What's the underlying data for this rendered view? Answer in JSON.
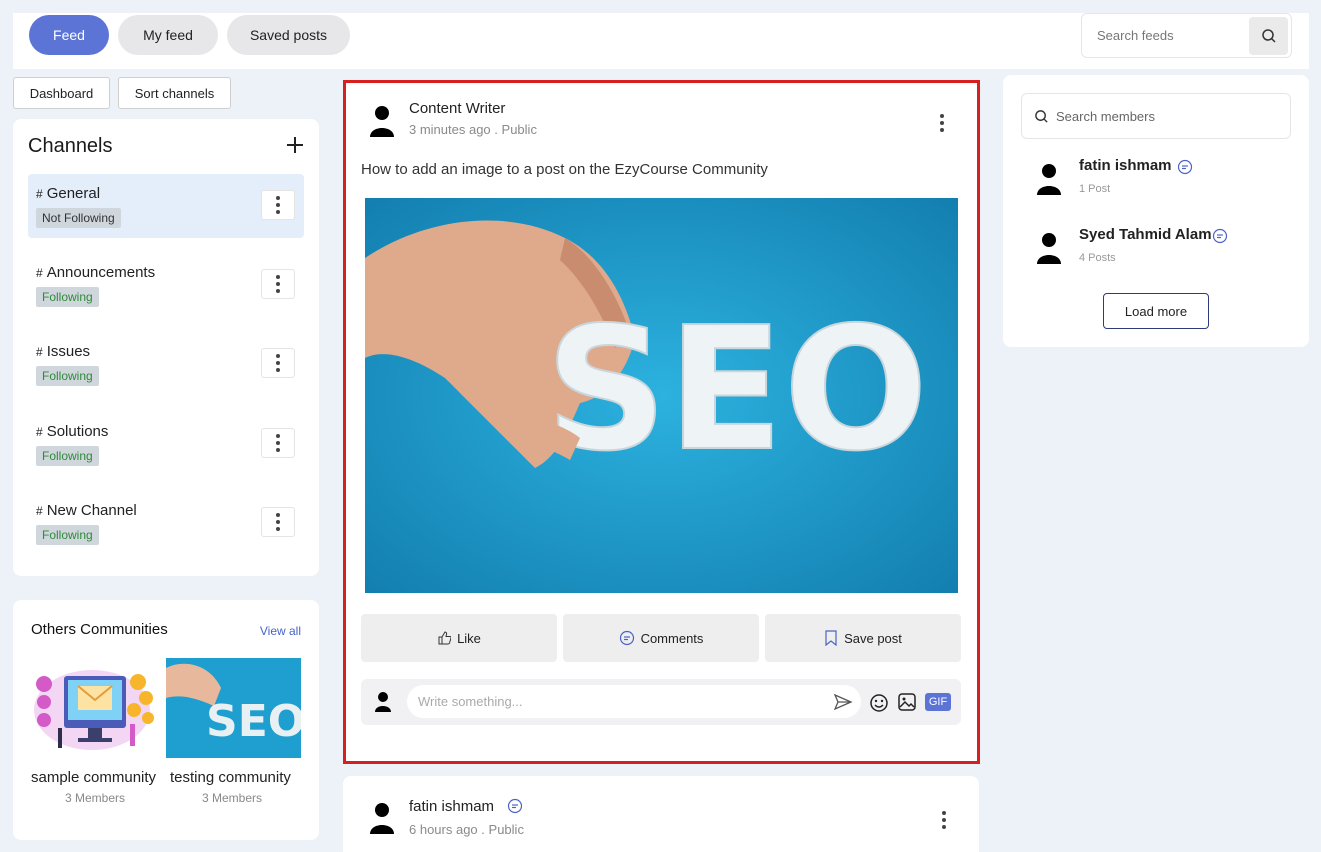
{
  "tabs": [
    {
      "label": "Feed",
      "active": true
    },
    {
      "label": "My feed",
      "active": false
    },
    {
      "label": "Saved posts",
      "active": false
    }
  ],
  "search_feeds": {
    "placeholder": "Search feeds"
  },
  "toolbar": {
    "dashboard_label": "Dashboard",
    "sort_label": "Sort channels"
  },
  "channels": {
    "title": "Channels",
    "items": [
      {
        "name": "General",
        "status": "Not Following",
        "active": true
      },
      {
        "name": "Announcements",
        "status": "Following",
        "active": false
      },
      {
        "name": "Issues",
        "status": "Following",
        "active": false
      },
      {
        "name": "Solutions",
        "status": "Following",
        "active": false
      },
      {
        "name": "New Channel",
        "status": "Following",
        "active": false
      }
    ]
  },
  "other_communities": {
    "title": "Others Communities",
    "view_all": "View all",
    "items": [
      {
        "name": "sample community",
        "members": "3 Members"
      },
      {
        "name": "testing community",
        "members": "3 Members"
      }
    ]
  },
  "post": {
    "author": "Content Writer",
    "time": "3 minutes ago",
    "visibility": "Public",
    "text": "How to add an image to a post on the EzyCourse Community",
    "image_text": "SEO",
    "actions": {
      "like": "Like",
      "comments": "Comments",
      "save": "Save post"
    },
    "comment_placeholder": "Write something...",
    "gif_label": "GIF"
  },
  "post2": {
    "author": "fatin ishmam",
    "time": "6 hours ago",
    "visibility": "Public"
  },
  "members": {
    "search_placeholder": "Search members",
    "items": [
      {
        "name": "fatin ishmam",
        "posts": "1 Post"
      },
      {
        "name": "Syed Tahmid Alam",
        "posts": "4 Posts"
      }
    ],
    "load_more": "Load more"
  },
  "colors": {
    "accent": "#5b74d6",
    "highlight_border": "#d71f1f",
    "following_text": "#2f8a3a",
    "image_bg": "#1e9fd0"
  }
}
